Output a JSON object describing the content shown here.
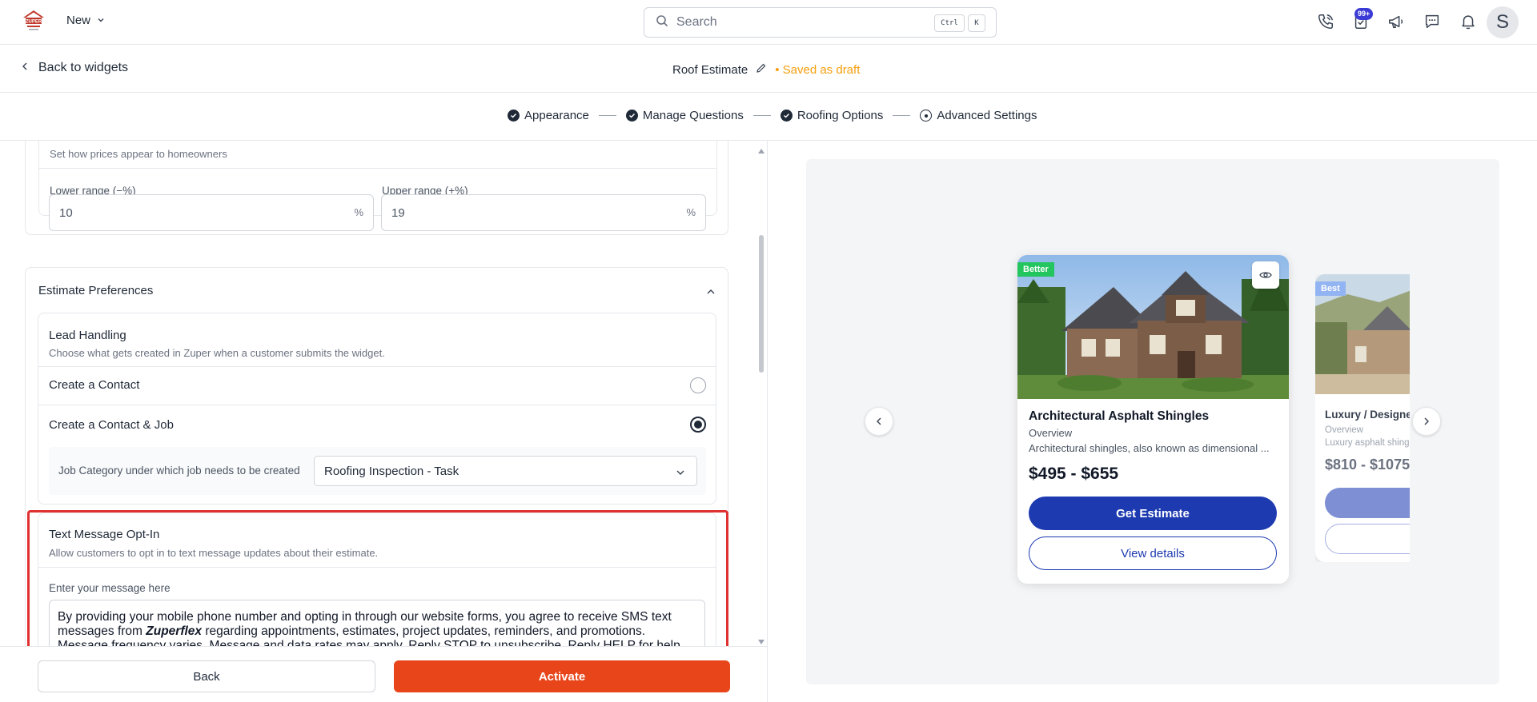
{
  "topbar": {
    "new_label": "New",
    "search_placeholder": "Search",
    "kbd_ctrl": "Ctrl",
    "kbd_k": "K",
    "notification_badge": "99+",
    "avatar_initial": "S",
    "brand_color": "#e8461a"
  },
  "header": {
    "back_label": "Back to widgets",
    "title": "Roof Estimate",
    "status": "• Saved as draft"
  },
  "stepper": {
    "steps": [
      {
        "label": "Appearance",
        "state": "done"
      },
      {
        "label": "Manage Questions",
        "state": "done"
      },
      {
        "label": "Roofing Options",
        "state": "done"
      },
      {
        "label": "Advanced Settings",
        "state": "current"
      }
    ]
  },
  "pricing": {
    "description": "Set how prices appear to homeowners",
    "lower_label": "Lower range (−%)",
    "lower_value": "10",
    "upper_label": "Upper range (+%)",
    "upper_value": "19",
    "unit": "%"
  },
  "estimate_preferences": {
    "title": "Estimate Preferences",
    "lead_handling": {
      "title": "Lead Handling",
      "description": "Choose what gets created in Zuper when a customer submits the widget.",
      "options": [
        {
          "label": "Create a Contact",
          "selected": false
        },
        {
          "label": "Create a Contact & Job",
          "selected": true
        }
      ],
      "job_category_label": "Job Category under which job needs to be created",
      "job_category_value": "Roofing Inspection - Task"
    },
    "sms_opt_in": {
      "title": "Text Message Opt-In",
      "description": "Allow customers to opt in to text message updates about their estimate.",
      "message_label": "Enter your message here",
      "message_part1": "By providing your mobile phone number and opting in through our website forms, you agree to receive SMS text messages from ",
      "message_brand": "Zuperflex",
      "message_part2": " regarding appointments, estimates, project updates, reminders, and promotions. Message frequency varies. Message and data rates may apply. Reply STOP to unsubscribe. Reply HELP for help."
    }
  },
  "footer": {
    "back_label": "Back",
    "activate_label": "Activate"
  },
  "preview": {
    "cards": [
      {
        "tag": "Better",
        "tag_color": "#22c55e",
        "title": "Architectural Asphalt Shingles",
        "overview": "Overview",
        "description": "Architectural shingles, also known as dimensional ...",
        "price": "$495 - $655",
        "primary_btn": "Get Estimate",
        "secondary_btn": "View details"
      },
      {
        "tag": "Best",
        "tag_color": "#93b4f2",
        "title": "Luxury / Designer",
        "overview": "Overview",
        "description": "Luxury asphalt shingles",
        "price": "$810 - $1075"
      }
    ]
  }
}
